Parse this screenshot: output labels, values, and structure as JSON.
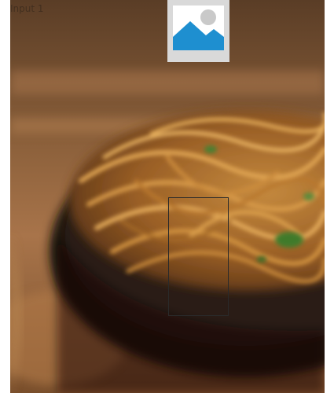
{
  "canvas": {
    "input_label": "Input 1",
    "image_subject": "noodle-bowl-photo",
    "placeholder_icon": "image-placeholder-icon",
    "colors": {
      "placeholder_bg": "#d9d9d9",
      "placeholder_sky": "#1e8fd0",
      "crop_border": "#2a2a2a"
    }
  }
}
